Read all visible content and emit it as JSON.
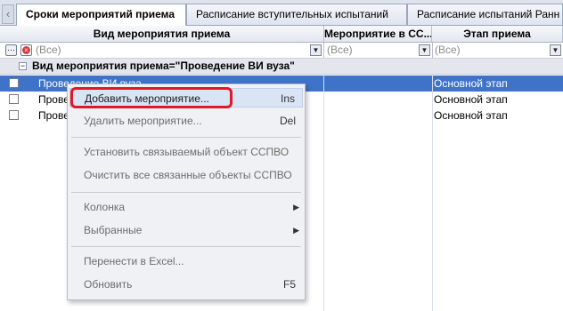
{
  "tabs": [
    {
      "label": "Сроки мероприятий приема",
      "active": true
    },
    {
      "label": "Расписание вступительных испытаний",
      "active": false
    },
    {
      "label": "Расписание испытаний Ранн",
      "active": false
    }
  ],
  "grid": {
    "columns": [
      "Вид мероприятия приема",
      "Мероприятие в СС...",
      "Этап приема"
    ],
    "filters": [
      "(Все)",
      "(Все)",
      "(Все)"
    ],
    "group_label": "Вид мероприятия приема=\"Проведение ВИ вуза\"",
    "rows": [
      {
        "name": "Проведение ВИ вуза",
        "stage": "Основной этап",
        "selected": true
      },
      {
        "name": "Прове",
        "stage": "Основной этап",
        "selected": false
      },
      {
        "name": "Прове",
        "stage": "Основной этап",
        "selected": false
      }
    ]
  },
  "context_menu": {
    "items": [
      {
        "label": "Добавить мероприятие...",
        "shortcut": "Ins"
      },
      {
        "label": "Удалить мероприятие...",
        "shortcut": "Del"
      },
      {
        "label": "Установить связываемый объект ССПВО",
        "shortcut": ""
      },
      {
        "label": "Очистить все связанные объекты ССПВО",
        "shortcut": ""
      },
      {
        "label": "Колонка",
        "shortcut": ""
      },
      {
        "label": "Выбранные",
        "shortcut": ""
      },
      {
        "label": "Перенести в Excel...",
        "shortcut": ""
      },
      {
        "label": "Обновить",
        "shortcut": "F5"
      }
    ]
  },
  "colors": {
    "selection": "#3f72c9",
    "highlight_box": "#e01827"
  }
}
